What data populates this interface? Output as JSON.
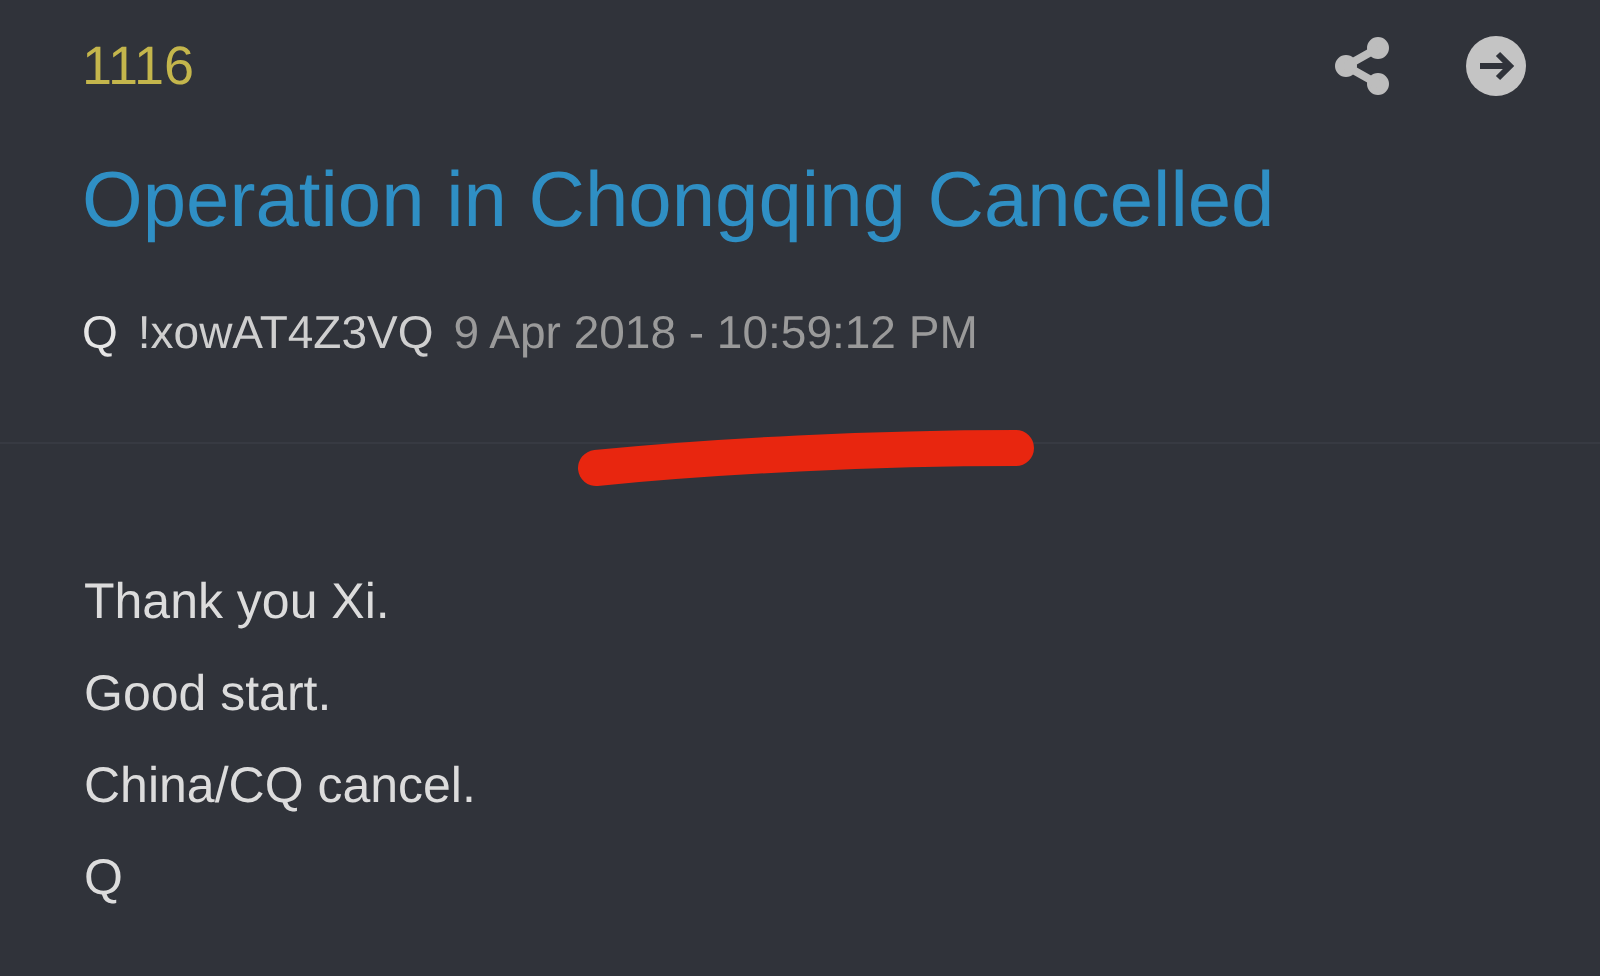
{
  "post": {
    "number": "1116",
    "title": "Operation in Chongqing Cancelled",
    "author": "Q",
    "tripcode": "!xowAT4Z3VQ",
    "date": "9 Apr 2018 - 10:59:12 PM",
    "markup": {
      "kind": "underline"
    },
    "body": [
      "Thank you Xi.",
      "Good start.",
      "China/CQ cancel.",
      "Q"
    ]
  }
}
